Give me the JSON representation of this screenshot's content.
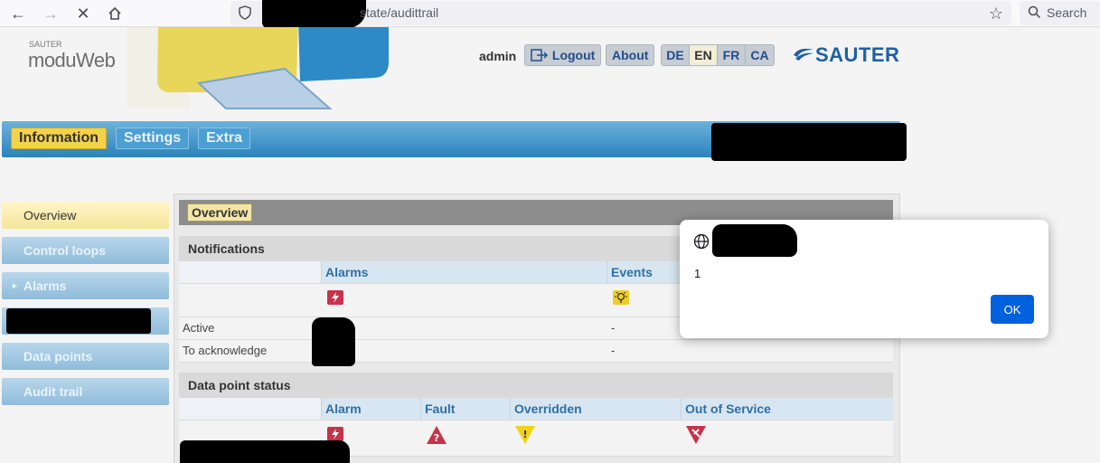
{
  "browser": {
    "url_visible": "state/audittrail",
    "search_label": "Search"
  },
  "app": {
    "brand_small": "SAUTER",
    "brand_name": "moduWeb",
    "user": "admin",
    "logout_label": "Logout",
    "about_label": "About",
    "languages": [
      "DE",
      "EN",
      "FR",
      "CA"
    ],
    "active_language": "EN",
    "logo_text": "SAUTER"
  },
  "tabs": [
    {
      "label": "Information",
      "active": true
    },
    {
      "label": "Settings",
      "active": false
    },
    {
      "label": "Extra",
      "active": false
    }
  ],
  "sidebar": [
    {
      "label": "Overview",
      "active": true
    },
    {
      "label": "Control loops",
      "active": false
    },
    {
      "label": "Alarms",
      "active": false,
      "has_arrow": true
    },
    {
      "label": "",
      "active": false,
      "redacted": true
    },
    {
      "label": "Data points",
      "active": false
    },
    {
      "label": "Audit trail",
      "active": false
    }
  ],
  "main": {
    "panel_title": "Overview",
    "notifications": {
      "title": "Notifications",
      "columns": [
        "Alarms",
        "Events"
      ],
      "rows": [
        {
          "label": "Active",
          "alarms": "",
          "events": "-"
        },
        {
          "label": "To acknowledge",
          "alarms": "",
          "events": "-"
        }
      ]
    },
    "datapoint_status": {
      "title": "Data point status",
      "columns": [
        "Alarm",
        "Fault",
        "Overridden",
        "Out of Service"
      ]
    }
  },
  "dialog": {
    "message": "1",
    "ok_label": "OK"
  },
  "colors": {
    "accent_blue": "#2a83bb",
    "active_yellow": "#f4d24a",
    "alarm_red": "#c8324a",
    "warning_yellow": "#f2d21a",
    "dialog_button": "#0061e0"
  }
}
